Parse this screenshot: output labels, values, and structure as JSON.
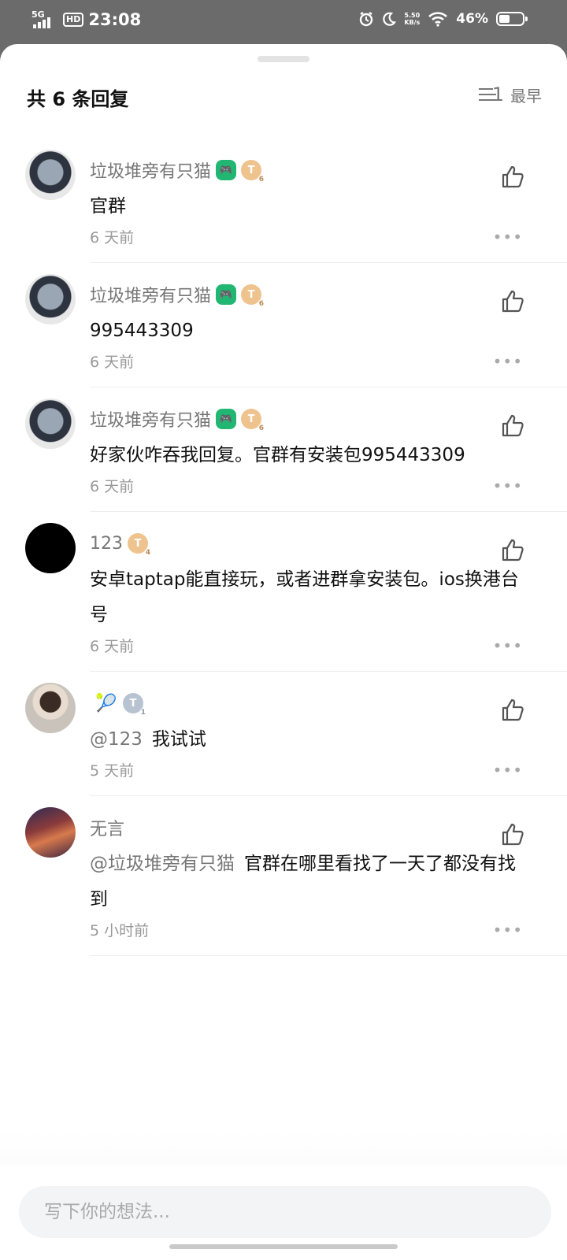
{
  "status_bar": {
    "network": "5G",
    "hd": "HD",
    "time": "23:08",
    "net_speed_value": "5.50",
    "net_speed_unit": "KB/s",
    "battery_text": "46%",
    "battery_level": 0.46
  },
  "header": {
    "title": "共 6 条回复",
    "sort_icon_glyph": "1",
    "sort_label": "最早"
  },
  "comments": [
    {
      "username": "垃圾堆旁有只猫",
      "avatar": "ink-portrait-avatar",
      "badges": {
        "b1": "controller-badge",
        "t_level": "6"
      },
      "mention": "",
      "text": "官群",
      "time": "6 天前"
    },
    {
      "username": "垃圾堆旁有只猫",
      "avatar": "ink-portrait-avatar",
      "badges": {
        "b1": "controller-badge",
        "t_level": "6"
      },
      "mention": "",
      "text": "995443309",
      "time": "6 天前"
    },
    {
      "username": "垃圾堆旁有只猫",
      "avatar": "ink-portrait-avatar",
      "badges": {
        "b1": "controller-badge",
        "t_level": "6"
      },
      "mention": "",
      "text": "好家伙咋吞我回复。官群有安装包995443309",
      "time": "6 天前"
    },
    {
      "username": "123",
      "avatar": "black-avatar",
      "badges": {
        "t_level": "4"
      },
      "mention": "",
      "text": "安卓taptap能直接玩，或者进群拿安装包。ios换港台号",
      "time": "6 天前"
    },
    {
      "username": "",
      "avatar": "person-avatar",
      "badges": {
        "emoji": "🎾",
        "t_level": "1"
      },
      "mention": "@123",
      "text": "我试试",
      "time": "5 天前"
    },
    {
      "username": "无言",
      "avatar": "sunset-avatar",
      "badges": {},
      "mention": "@垃圾堆旁有只猫",
      "text": "官群在哪里看找了一天了都没有找到",
      "time": "5 小时前"
    }
  ],
  "ui": {
    "more_glyph": "•••",
    "t_glyph": "T",
    "controller_glyph": "🎮"
  },
  "footer": {
    "input_placeholder": "写下你的想法..."
  },
  "colors": {
    "accent_green": "#22b673",
    "badge_gold": "#efc38e",
    "badge_grey": "#b8c3d2",
    "muted_text": "#777777"
  }
}
